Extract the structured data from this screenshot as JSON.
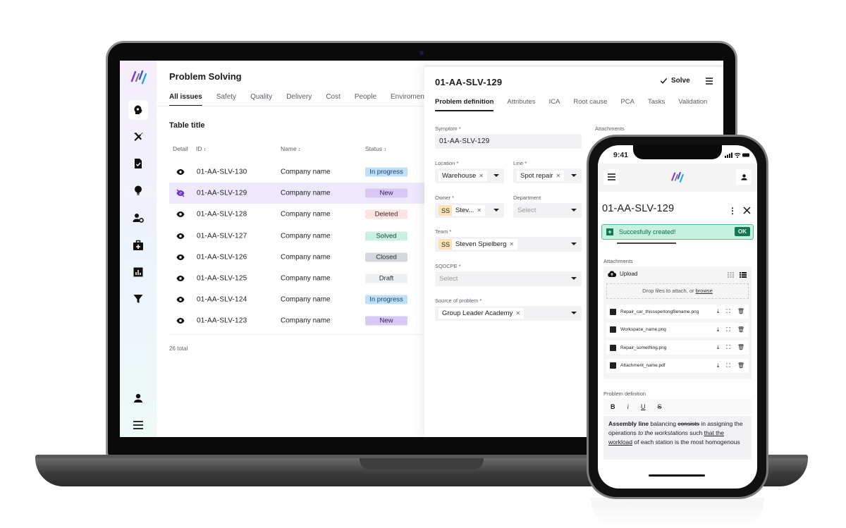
{
  "desktop": {
    "page_title": "Problem Solving",
    "tabs": [
      {
        "label": "All issues",
        "active": true
      },
      {
        "label": "Safety"
      },
      {
        "label": "Quality"
      },
      {
        "label": "Delivery"
      },
      {
        "label": "Cost"
      },
      {
        "label": "People"
      },
      {
        "label": "Enviroment"
      }
    ],
    "table_title": "Table title",
    "columns": [
      "Detail",
      "ID",
      "Name",
      "Status"
    ],
    "sort_glyph": "↕",
    "rows": [
      {
        "id": "01-AA-SLV-130",
        "name": "Company name",
        "status": "In progress"
      },
      {
        "id": "01-AA-SLV-129",
        "name": "Company name",
        "status": "New",
        "selected": true
      },
      {
        "id": "01-AA-SLV-128",
        "name": "Company name",
        "status": "Deleted"
      },
      {
        "id": "01-AA-SLV-127",
        "name": "Company name",
        "status": "Solved"
      },
      {
        "id": "01-AA-SLV-126",
        "name": "Company name",
        "status": "Closed"
      },
      {
        "id": "01-AA-SLV-125",
        "name": "Company name",
        "status": "Draft"
      },
      {
        "id": "01-AA-SLV-124",
        "name": "Company name",
        "status": "In progress"
      },
      {
        "id": "01-AA-SLV-123",
        "name": "Company name",
        "status": "New"
      }
    ],
    "total": "26 total",
    "status_colors": {
      "In progress": {
        "bg": "#bfe0fb",
        "fg": "#1c3d5e"
      },
      "New": {
        "bg": "#d7c8f5",
        "fg": "#2b1f55"
      },
      "Deleted": {
        "bg": "#fbe4e4",
        "fg": "#3a2a2a"
      },
      "Solved": {
        "bg": "#c9f0e1",
        "fg": "#1f3d33"
      },
      "Closed": {
        "bg": "#d4d7dc",
        "fg": "#2b2d31"
      },
      "Draft": {
        "bg": "#eef0f2",
        "fg": "#2b2d31"
      }
    },
    "sidebar": [
      "problem-solving-icon",
      "tools-icon",
      "task-document-icon",
      "idea-bulb-icon",
      "user-settings-icon",
      "first-aid-kit-icon",
      "analytics-icon",
      "filter-icon",
      "user-icon",
      "menu-icon"
    ],
    "detail": {
      "title": "01-AA-SLV-129",
      "solve_label": "Solve",
      "tabs": [
        {
          "label": "Problem definition",
          "active": true
        },
        {
          "label": "Attributes"
        },
        {
          "label": "ICA"
        },
        {
          "label": "Root cause"
        },
        {
          "label": "PCA"
        },
        {
          "label": "Tasks"
        },
        {
          "label": "Validation"
        }
      ],
      "symptom_label": "Symptom *",
      "symptom_value": "01-AA-SLV-129",
      "attachments_label": "Attachments",
      "location_label": "Location *",
      "location_value": "Warehouse",
      "line_label": "Line *",
      "line_value": "Spot repair",
      "owner_label": "Owner *",
      "owner_initials": "SS",
      "owner_value": "Stev...",
      "department_label": "Department",
      "department_placeholder": "Select",
      "team_label": "Team *",
      "team_initials": "SS",
      "team_value": "Steven Spielberg",
      "sqdcpe_label": "SQDCPE",
      "sqdcpe_required": "*",
      "sqdcpe_placeholder": "Select",
      "source_label": "Source of problem *",
      "source_value": "Group Leader Academy"
    }
  },
  "mobile": {
    "time": "9:41",
    "title": "01-AA-SLV-129",
    "toast": {
      "text": "Succesfully created!",
      "button": "OK"
    },
    "attachments_label": "Attachments",
    "upload_label": "Upload",
    "drop_text": "Drop files to attach, or",
    "browse_link": "browse",
    "files": [
      {
        "name": "Repair_car_thissuperlongfilename.png",
        "type": "image"
      },
      {
        "name": "Workspace_name.png",
        "type": "image"
      },
      {
        "name": "Repair_something.png",
        "type": "image"
      },
      {
        "name": "Attachment_name.pdf",
        "type": "pdf"
      }
    ],
    "problem_definition_label": "Problem definition",
    "editor": {
      "toolbar": [
        "B",
        "i",
        "U",
        "S"
      ],
      "bold": "Assembly line",
      "t1": " balancing ",
      "strike": "consists",
      "t2": " in assigning the operations ",
      "italic": "to the workstations",
      "t3": " such ",
      "underline": "that the workload",
      "t4": " of each station is the most homogenous"
    }
  }
}
